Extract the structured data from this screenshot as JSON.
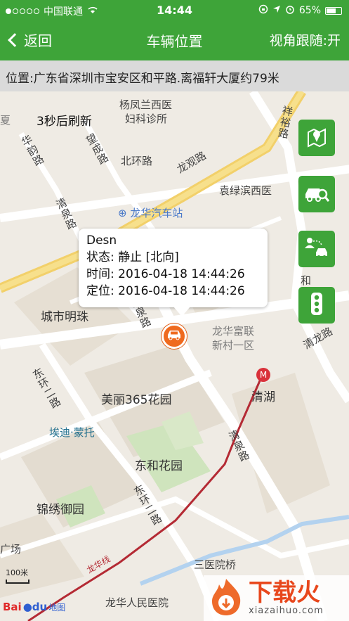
{
  "status": {
    "carrier": "中国联通",
    "time": "14:44",
    "battery": "65%",
    "battery_level": 0.65
  },
  "nav": {
    "back_label": "返回",
    "title": "车辆位置",
    "follow_label": "视角跟随:开"
  },
  "address": "位置:广东省深圳市宝安区和平路.离福轩大厦约79米",
  "map": {
    "refresh_text": "3秒后刷新",
    "labels": {
      "yangfenglan": "杨凤兰西医",
      "fuke": "妇科诊所",
      "huarun": "华韵路",
      "wangcheng": "望成路",
      "beihuan": "北环路",
      "longguan": "龙观路",
      "yuanlv": "袁绿滨西医",
      "xiangyi": "祥裕路",
      "qingquan_top": "清泉路",
      "bus_station": "龙华汽车站",
      "chengshi": "城市明珠",
      "qingquan_mid": "清泉路",
      "fuliancun": "龙华富联",
      "fuliancun2": "新村一区",
      "he": "和",
      "qinglong": "清龙路",
      "dongyuan": "东环二路",
      "meili": "美丽365花园",
      "qinghu": "清湖",
      "yidi": "埃迪·蒙托",
      "qingquan_low": "清泉路",
      "donghe": "东和花园",
      "donghuan": "东环二路",
      "jinxiu": "锦绣御园",
      "guangchang": "广场",
      "sanyi": "三医院桥",
      "longhua_line": "龙华线",
      "hospital": "龙华人民医院",
      "xia": "夏"
    },
    "scale_label": "100米",
    "baidu_label": "地图",
    "watermark_main": "下载火",
    "watermark_sub": "xiazaihuo.com"
  },
  "popup": {
    "name": "Desn",
    "status": "状态: 静止 [北向]",
    "time": "时间: 2016-04-18 14:44:26",
    "locate": "定位: 2016-04-18 14:44:26"
  },
  "side_buttons": [
    "map-pin-icon",
    "car-search-icon",
    "person-car-route-icon",
    "traffic-light-icon"
  ]
}
